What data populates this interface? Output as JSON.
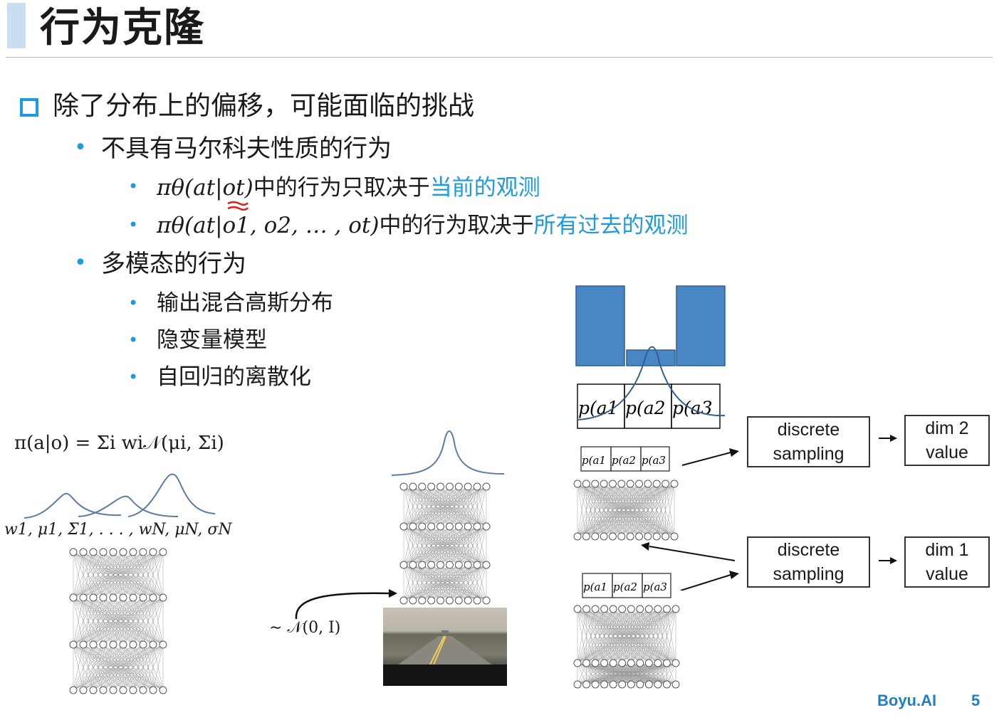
{
  "slide": {
    "title": "行为克隆",
    "bullets": {
      "main": "除了分布上的偏移，可能面临的挑战",
      "sub1": "不具有马尔科夫性质的行为",
      "sub1_items": [
        {
          "formula": "πθ(at|ot)",
          "text": "中的行为只取决于",
          "highlight": "当前的观测"
        },
        {
          "formula": "πθ(at|o1, o2, … , ot)",
          "text": "中的行为取决于",
          "highlight": "所有过去的观测"
        }
      ],
      "sub2": "多模态的行为",
      "sub2_items": [
        "输出混合高斯分布",
        "隐变量模型",
        "自回归的离散化"
      ]
    },
    "footer": {
      "brand": "Boyu.AI",
      "page": "5"
    },
    "accent_color": "#1e9be0"
  },
  "figure": {
    "gmm_formula": "π(a|o) = Σi wi𝒩(μi, Σi)",
    "gmm_params": "w1, μ1, Σ1, . . . , wN, μN, σN",
    "latent_noise": "∼ 𝒩(0, I)",
    "prob_labels": [
      "p(a1",
      "p(a2",
      "p(a3"
    ],
    "boxes": [
      {
        "label_line1": "discrete",
        "label_line2": "sampling"
      },
      {
        "label_line1": "dim 2",
        "label_line2": "value"
      },
      {
        "label_line1": "discrete",
        "label_line2": "sampling"
      },
      {
        "label_line1": "dim 1",
        "label_line2": "value"
      }
    ]
  }
}
